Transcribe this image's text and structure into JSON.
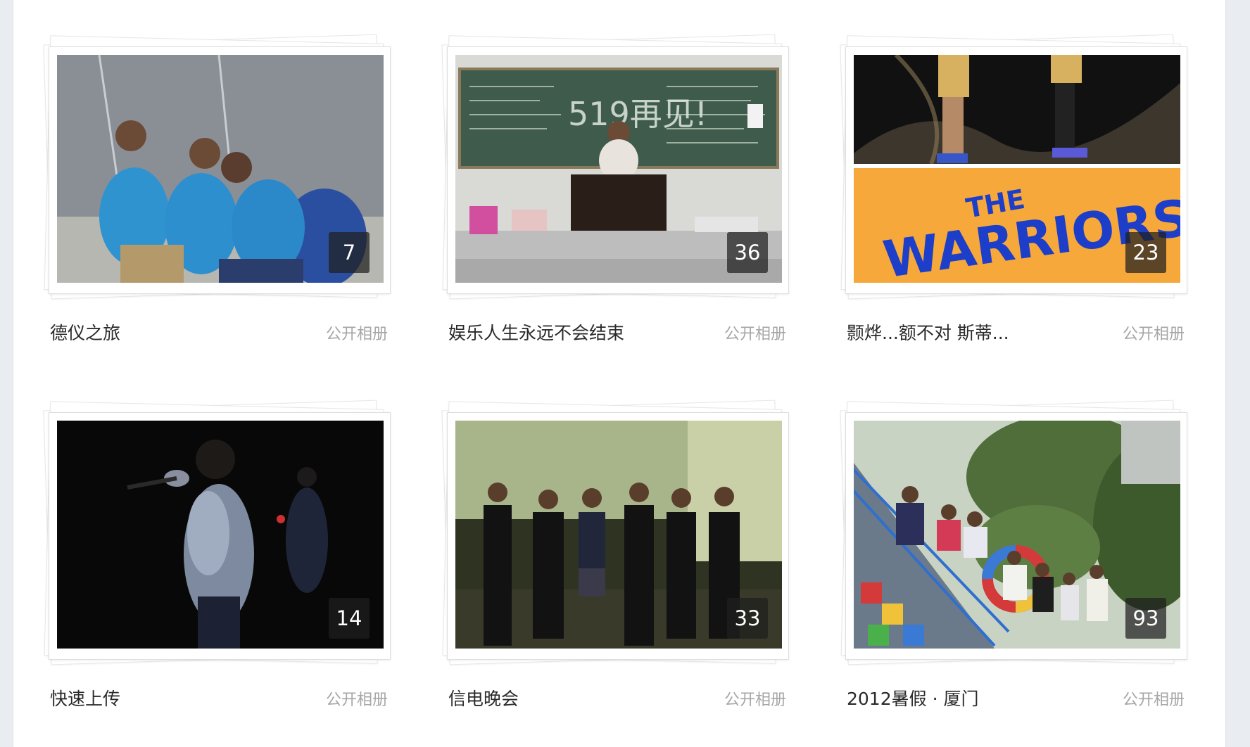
{
  "albums": [
    {
      "title": "德仪之旅",
      "type": "公开相册",
      "count": "7",
      "thumbnail": "three-students-blue-shirts-photo"
    },
    {
      "title": "娱乐人生永远不会结束",
      "type": "公开相册",
      "count": "36",
      "thumbnail": "classroom-blackboard-photo"
    },
    {
      "title": "颢烨...额不对 斯蒂...",
      "type": "公开相册",
      "count": "23",
      "thumbnail": "warriors-logo-image"
    },
    {
      "title": "快速上传",
      "type": "公开相册",
      "count": "14",
      "thumbnail": "singer-on-stage-photo"
    },
    {
      "title": "信电晚会",
      "type": "公开相册",
      "count": "33",
      "thumbnail": "group-in-suits-photo"
    },
    {
      "title": "2012暑假 · 厦门",
      "type": "公开相册",
      "count": "93",
      "thumbnail": "group-on-staircase-photo"
    }
  ],
  "colors": {
    "background": "#e9edf2",
    "card": "#ffffff",
    "title_text": "#2a2a2a",
    "type_text": "#a6a6a6"
  }
}
